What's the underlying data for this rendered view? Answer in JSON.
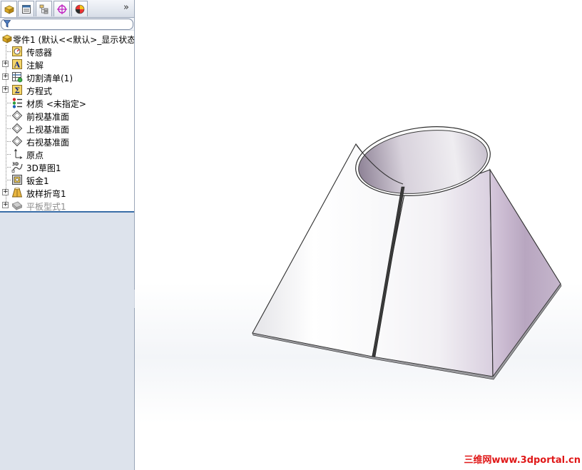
{
  "panel": {
    "tabs": [
      {
        "name": "feature-manager-tab",
        "icon": "feature-tree-icon",
        "active": true
      },
      {
        "name": "property-manager-tab",
        "icon": "property-manager-icon",
        "active": false
      },
      {
        "name": "configuration-manager-tab",
        "icon": "configuration-manager-icon",
        "active": false
      },
      {
        "name": "dimxpert-manager-tab",
        "icon": "dimxpert-crosshair-icon",
        "active": false
      },
      {
        "name": "display-manager-tab",
        "icon": "display-manager-icon",
        "active": false
      }
    ],
    "more_tabs_label": "»",
    "filter_icon": "funnel-filter-icon"
  },
  "tree": {
    "root": {
      "label": "零件1  (默认<<默认>_显示状态",
      "icon": "part-icon"
    },
    "items": [
      {
        "label": "传感器",
        "icon": "sensor-icon",
        "expandable": false,
        "disabled": false
      },
      {
        "label": "注解",
        "icon": "annotation-icon",
        "expandable": true,
        "disabled": false
      },
      {
        "label": "切割清单(1)",
        "icon": "cut-list-icon",
        "expandable": true,
        "disabled": false
      },
      {
        "label": "方程式",
        "icon": "equation-icon",
        "expandable": true,
        "disabled": false
      },
      {
        "label": "材质 <未指定>",
        "icon": "material-icon",
        "expandable": false,
        "disabled": false
      },
      {
        "label": "前视基准面",
        "icon": "plane-icon",
        "expandable": false,
        "disabled": false
      },
      {
        "label": "上视基准面",
        "icon": "plane-icon",
        "expandable": false,
        "disabled": false
      },
      {
        "label": "右视基准面",
        "icon": "plane-icon",
        "expandable": false,
        "disabled": false
      },
      {
        "label": "原点",
        "icon": "origin-icon",
        "expandable": false,
        "disabled": false
      },
      {
        "label": "3D草图1",
        "icon": "sketch-3d-icon",
        "expandable": false,
        "disabled": false
      },
      {
        "label": "钣金1",
        "icon": "sheet-metal-icon",
        "expandable": false,
        "disabled": false
      },
      {
        "label": "放样折弯1",
        "icon": "lofted-bend-icon",
        "expandable": true,
        "disabled": false
      },
      {
        "label": "平板型式1",
        "icon": "flat-pattern-icon",
        "expandable": true,
        "disabled": true
      }
    ]
  },
  "viewport": {
    "model": "lofted-sheet-metal-part",
    "watermark": "三维网www.3dportal.cn"
  },
  "colors": {
    "panel_bg": "#dde3ec",
    "tree_bg": "#ffffff",
    "separator": "#3a6ea8",
    "watermark": "#e01818",
    "model_shadow": "#b7a5bf"
  }
}
